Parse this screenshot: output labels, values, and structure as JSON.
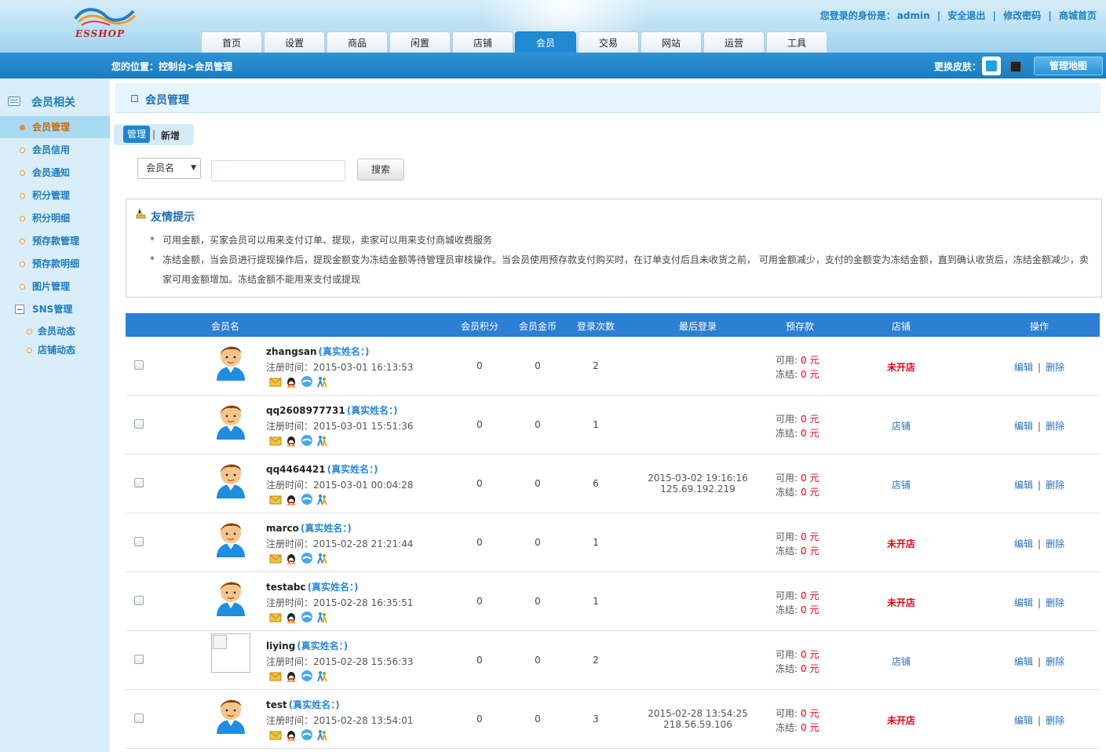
{
  "header": {
    "logo_text": "ESSHOP",
    "login_identity_label": "您登录的身份是：",
    "username": "admin",
    "links": [
      "安全退出",
      "修改密码",
      "商城首页"
    ]
  },
  "nav": {
    "tabs": [
      "首页",
      "设置",
      "商品",
      "闲置",
      "店铺",
      "会员",
      "交易",
      "网站",
      "运营",
      "工具"
    ],
    "active": "会员"
  },
  "bluebar": {
    "breadcrumb": "您的位置：控制台>会员管理",
    "skin_label": "更换皮肤：",
    "map_button": "管理地图"
  },
  "sidebar": {
    "heading": "会员相关",
    "items": [
      "会员管理",
      "会员信用",
      "会员通知",
      "积分管理",
      "积分明细",
      "预存款管理",
      "预存款明细",
      "图片管理"
    ],
    "active": "会员管理",
    "group": "SNS管理",
    "sub_items": [
      "会员动态",
      "店铺动态"
    ]
  },
  "main": {
    "title": "会员管理",
    "subtabs": {
      "manage": "管理",
      "separator": "|",
      "add": "新增"
    },
    "search": {
      "type_selected": "会员名",
      "input_value": "",
      "button": "搜索"
    },
    "tips": {
      "title": "友情提示",
      "items": [
        "可用金额，买家会员可以用来支付订单、提现，卖家可以用来支付商城收费服务",
        "冻结金额，当会员进行提现操作后，提现金额变为冻结金额等待管理员审核操作。当会员使用预存款支付购买时，在订单支付后且未收货之前， 可用金额减少，支付的金额变为冻结金额，直到确认收货后，冻结金额减少，卖家可用金额增加。冻结金额不能用来支付或提现"
      ]
    },
    "table": {
      "headers": [
        "会员名",
        "会员积分",
        "会员金币",
        "登录次数",
        "最后登录",
        "预存款",
        "店铺",
        "操作"
      ],
      "real_name_label": "(真实姓名：)",
      "reg_label": "注册时间：",
      "avail_label": "可用:",
      "frozen_label": "冻结:",
      "edit": "编辑",
      "op_sep": "|",
      "delete": "删除",
      "rows": [
        {
          "username": "zhangsan",
          "reg_time": "2015-03-01 16:13:53",
          "points": "0",
          "gold": "0",
          "logins": "2",
          "last_time": "",
          "last_ip": "",
          "available": "0 元",
          "frozen": "0 元",
          "store": "未开店",
          "store_open": false,
          "avatar": true
        },
        {
          "username": "qq2608977731",
          "reg_time": "2015-03-01 15:51:36",
          "points": "0",
          "gold": "0",
          "logins": "1",
          "last_time": "",
          "last_ip": "",
          "available": "0 元",
          "frozen": "0 元",
          "store": "店铺",
          "store_open": true,
          "avatar": true
        },
        {
          "username": "qq4464421",
          "reg_time": "2015-03-01 00:04:28",
          "points": "0",
          "gold": "0",
          "logins": "6",
          "last_time": "2015-03-02 19:16:16",
          "last_ip": "125.69.192.219",
          "available": "0 元",
          "frozen": "0 元",
          "store": "店铺",
          "store_open": true,
          "avatar": true
        },
        {
          "username": "marco",
          "reg_time": "2015-02-28 21:21:44",
          "points": "0",
          "gold": "0",
          "logins": "1",
          "last_time": "",
          "last_ip": "",
          "available": "0 元",
          "frozen": "0 元",
          "store": "未开店",
          "store_open": false,
          "avatar": true
        },
        {
          "username": "testabc",
          "reg_time": "2015-02-28 16:35:51",
          "points": "0",
          "gold": "0",
          "logins": "1",
          "last_time": "",
          "last_ip": "",
          "available": "0 元",
          "frozen": "0 元",
          "store": "未开店",
          "store_open": false,
          "avatar": true
        },
        {
          "username": "liying",
          "reg_time": "2015-02-28 15:56:33",
          "points": "0",
          "gold": "0",
          "logins": "2",
          "last_time": "",
          "last_ip": "",
          "available": "0 元",
          "frozen": "0 元",
          "store": "店铺",
          "store_open": true,
          "avatar": false
        },
        {
          "username": "test",
          "reg_time": "2015-02-28 13:54:01",
          "points": "0",
          "gold": "0",
          "logins": "3",
          "last_time": "2015-02-28 13:54:25",
          "last_ip": "218.56.59.106",
          "available": "0 元",
          "frozen": "0 元",
          "store": "未开店",
          "store_open": false,
          "avatar": true
        }
      ]
    }
  }
}
